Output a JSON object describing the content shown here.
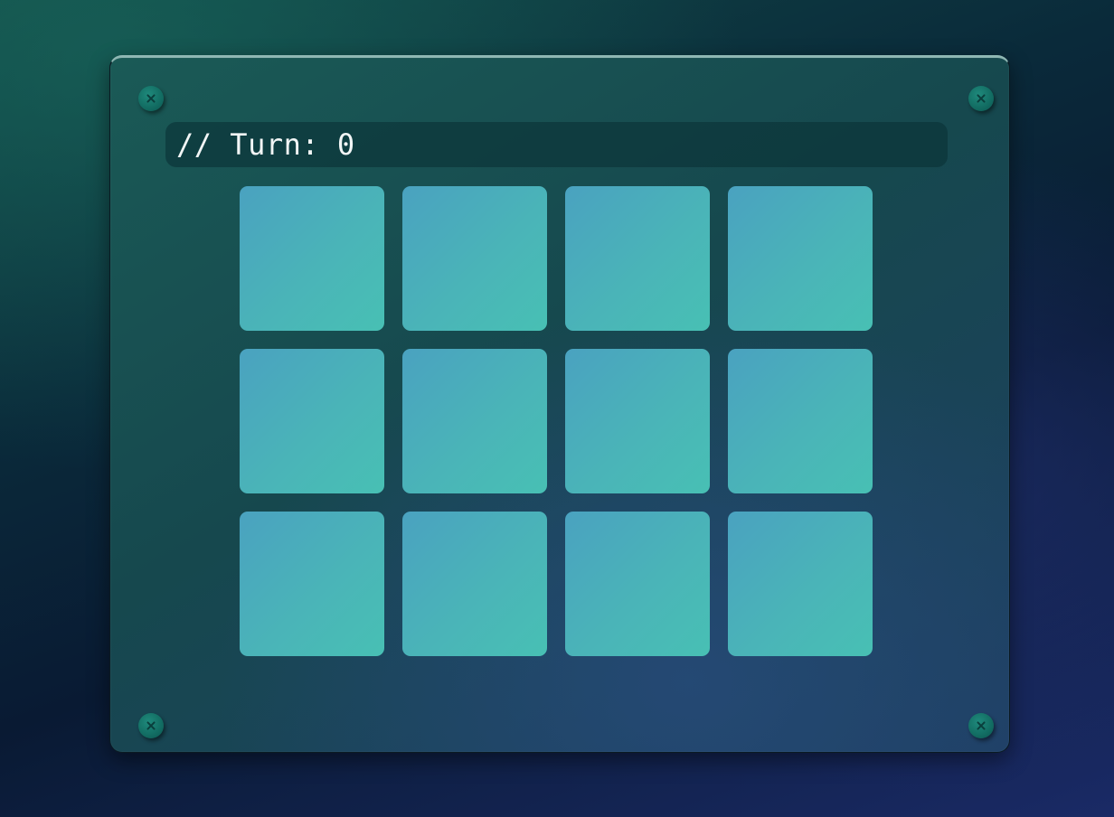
{
  "status": {
    "turn_text": "// Turn: 0"
  },
  "board": {
    "rows": 3,
    "columns": 4,
    "cards": [
      {
        "state": "face-down"
      },
      {
        "state": "face-down"
      },
      {
        "state": "face-down"
      },
      {
        "state": "face-down"
      },
      {
        "state": "face-down"
      },
      {
        "state": "face-down"
      },
      {
        "state": "face-down"
      },
      {
        "state": "face-down"
      },
      {
        "state": "face-down"
      },
      {
        "state": "face-down"
      },
      {
        "state": "face-down"
      },
      {
        "state": "face-down"
      }
    ]
  },
  "colors": {
    "card_gradient_start": "#4aa2c0",
    "card_gradient_end": "#48c0b4",
    "panel": "#1a5a56",
    "screw": "#126c62",
    "text": "#f2f6f6"
  },
  "icons": {
    "screw": "screw-icon"
  }
}
